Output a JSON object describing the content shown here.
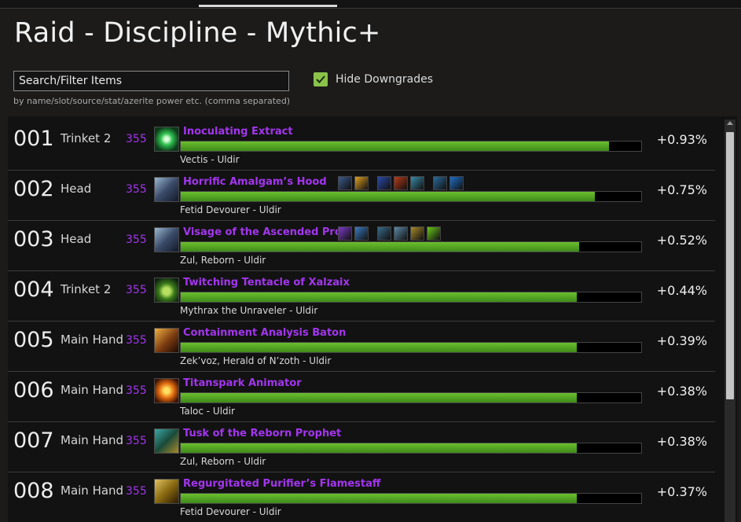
{
  "page": {
    "title": "Raid - Discipline - Mythic+",
    "search": {
      "placeholder": "Search/Filter Items",
      "hint": "by name/slot/source/stat/azerite power etc. (comma separated)"
    },
    "hide_downgrades": {
      "label": "Hide Downgrades",
      "checked": true
    }
  },
  "colors": {
    "epic": "#a335ee",
    "bar_fill": "#4fa12a",
    "checkbox": "#8bc34a"
  },
  "items": [
    {
      "rank": "001",
      "slot": "Trinket 2",
      "ilvl": "355",
      "name": "Inoculating Extract",
      "source": "Vectis - Uldir",
      "pct": "+0.93%",
      "fill": 0.93,
      "icon": "trinket-icon",
      "traits": []
    },
    {
      "rank": "002",
      "slot": "Head",
      "ilvl": "355",
      "name": "Horrific Amalgam’s Hood",
      "source": "Fetid Devourer - Uldir",
      "pct": "+0.75%",
      "fill": 0.9,
      "icon": "helm-icon",
      "traits": [
        [
          "#3a5a8a",
          "#e0a020"
        ],
        [
          "#2a4aa8",
          "#b83a1a",
          "#3a8aa8"
        ],
        [
          "#2a6a9a",
          "#1e6fc8"
        ]
      ]
    },
    {
      "rank": "003",
      "slot": "Head",
      "ilvl": "355",
      "name": "Visage of the Ascended Pro…",
      "source": "Zul, Reborn - Uldir",
      "pct": "+0.52%",
      "fill": 0.865,
      "icon": "helm-icon",
      "traits": [
        [
          "#7a3ac8",
          "#3a7ac0"
        ],
        [
          "#3a6a8a",
          "#5a8aa8",
          "#a88a2a",
          "#6ac81a"
        ]
      ]
    },
    {
      "rank": "004",
      "slot": "Trinket 2",
      "ilvl": "355",
      "name": "Twitching Tentacle of Xalzaix",
      "source": "Mythrax the Unraveler - Uldir",
      "pct": "+0.44%",
      "fill": 0.86,
      "icon": "tentacle-icon",
      "traits": []
    },
    {
      "rank": "005",
      "slot": "Main Hand",
      "ilvl": "355",
      "name": "Containment Analysis Baton",
      "source": "Zek’voz, Herald of N’zoth - Uldir",
      "pct": "+0.39%",
      "fill": 0.86,
      "icon": "mace-icon",
      "traits": []
    },
    {
      "rank": "006",
      "slot": "Main Hand",
      "ilvl": "355",
      "name": "Titanspark Animator",
      "source": "Taloc - Uldir",
      "pct": "+0.38%",
      "fill": 0.86,
      "icon": "orb-icon",
      "traits": []
    },
    {
      "rank": "007",
      "slot": "Main Hand",
      "ilvl": "355",
      "name": "Tusk of the Reborn Prophet",
      "source": "Zul, Reborn - Uldir",
      "pct": "+0.38%",
      "fill": 0.86,
      "icon": "tusk-icon",
      "traits": []
    },
    {
      "rank": "008",
      "slot": "Main Hand",
      "ilvl": "355",
      "name": "Regurgitated Purifier’s Flamestaff",
      "source": "Fetid Devourer - Uldir",
      "pct": "+0.37%",
      "fill": 0.86,
      "icon": "staff-icon",
      "traits": []
    }
  ]
}
